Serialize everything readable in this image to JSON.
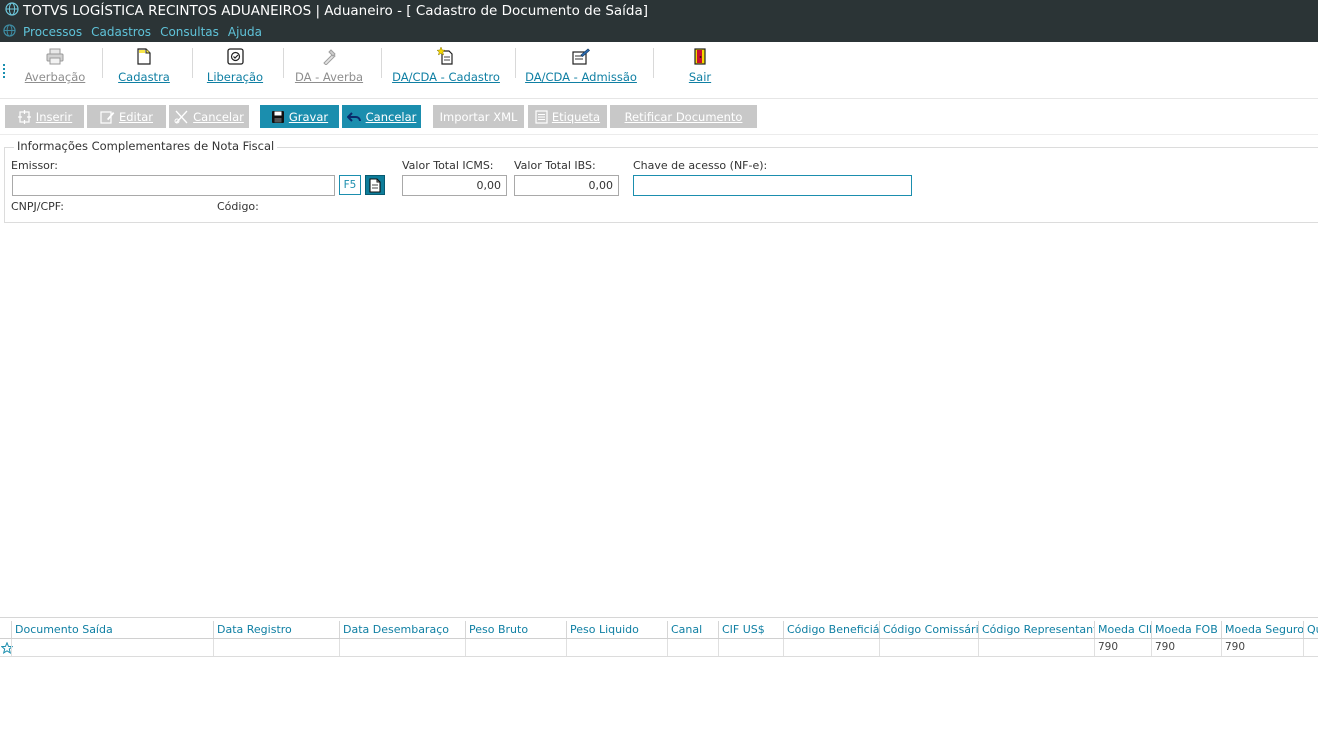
{
  "window": {
    "title": "TOTVS LOGÍSTICA RECINTOS ADUANEIROS | Aduaneiro - [ Cadastro de Documento de Saída]"
  },
  "menu": [
    "Processos",
    "Cadastros",
    "Consultas",
    "Ajuda"
  ],
  "ribbon": [
    {
      "label": "Averbação",
      "icon": "printer-icon",
      "enabled": false
    },
    {
      "label": "Cadastra",
      "icon": "document-icon",
      "enabled": true
    },
    {
      "label": "Liberação",
      "icon": "seal-icon",
      "enabled": true
    },
    {
      "label": "DA - Averba",
      "icon": "stamp-icon",
      "enabled": false
    },
    {
      "label": "DA/CDA - Cadastro",
      "icon": "document-star-icon",
      "enabled": true
    },
    {
      "label": "DA/CDA - Admissão",
      "icon": "document-edit-icon",
      "enabled": true
    },
    {
      "label": "Sair",
      "icon": "exit-door-icon",
      "enabled": true
    }
  ],
  "actions": {
    "inserir": "Inserir",
    "editar": "Editar",
    "cancelar_disabled": "Cancelar",
    "gravar": "Gravar",
    "cancelar": "Cancelar",
    "importar_xml": "Importar XML",
    "etiqueta": "Etiqueta",
    "retificar": "Retificar Documento"
  },
  "form": {
    "group_title": "Informações Complementares de Nota Fiscal",
    "emissor_label": "Emissor:",
    "emissor_value": "",
    "f5_label": "F5",
    "icms_label": "Valor Total ICMS:",
    "icms_value": "0,00",
    "ibs_label": "Valor Total IBS:",
    "ibs_value": "0,00",
    "chave_label": "Chave de acesso (NF-e):",
    "chave_value": "",
    "cnpj_label": "CNPJ/CPF:",
    "codigo_label": "Código:"
  },
  "grid": {
    "columns": [
      "Documento Saída",
      "Data Registro",
      "Data  Desembaraço",
      "Peso Bruto",
      "Peso Liquido",
      "Canal",
      "CIF US$",
      "Código Beneficiário",
      "Código Comissária",
      "Código Representante",
      "Moeda CIF",
      "Moeda FOB",
      "Moeda Seguro",
      "Qu"
    ],
    "rows": [
      [
        "",
        "",
        "",
        "",
        "",
        "",
        "",
        "",
        "",
        "",
        "790",
        "790",
        "790",
        ""
      ]
    ]
  },
  "colors": {
    "titlebar_bg": "#2b3436",
    "menu_text": "#5fc3d9",
    "accent": "#1b8eae",
    "link": "#0f7fa3",
    "disabled_button": "#c8c8c8"
  }
}
